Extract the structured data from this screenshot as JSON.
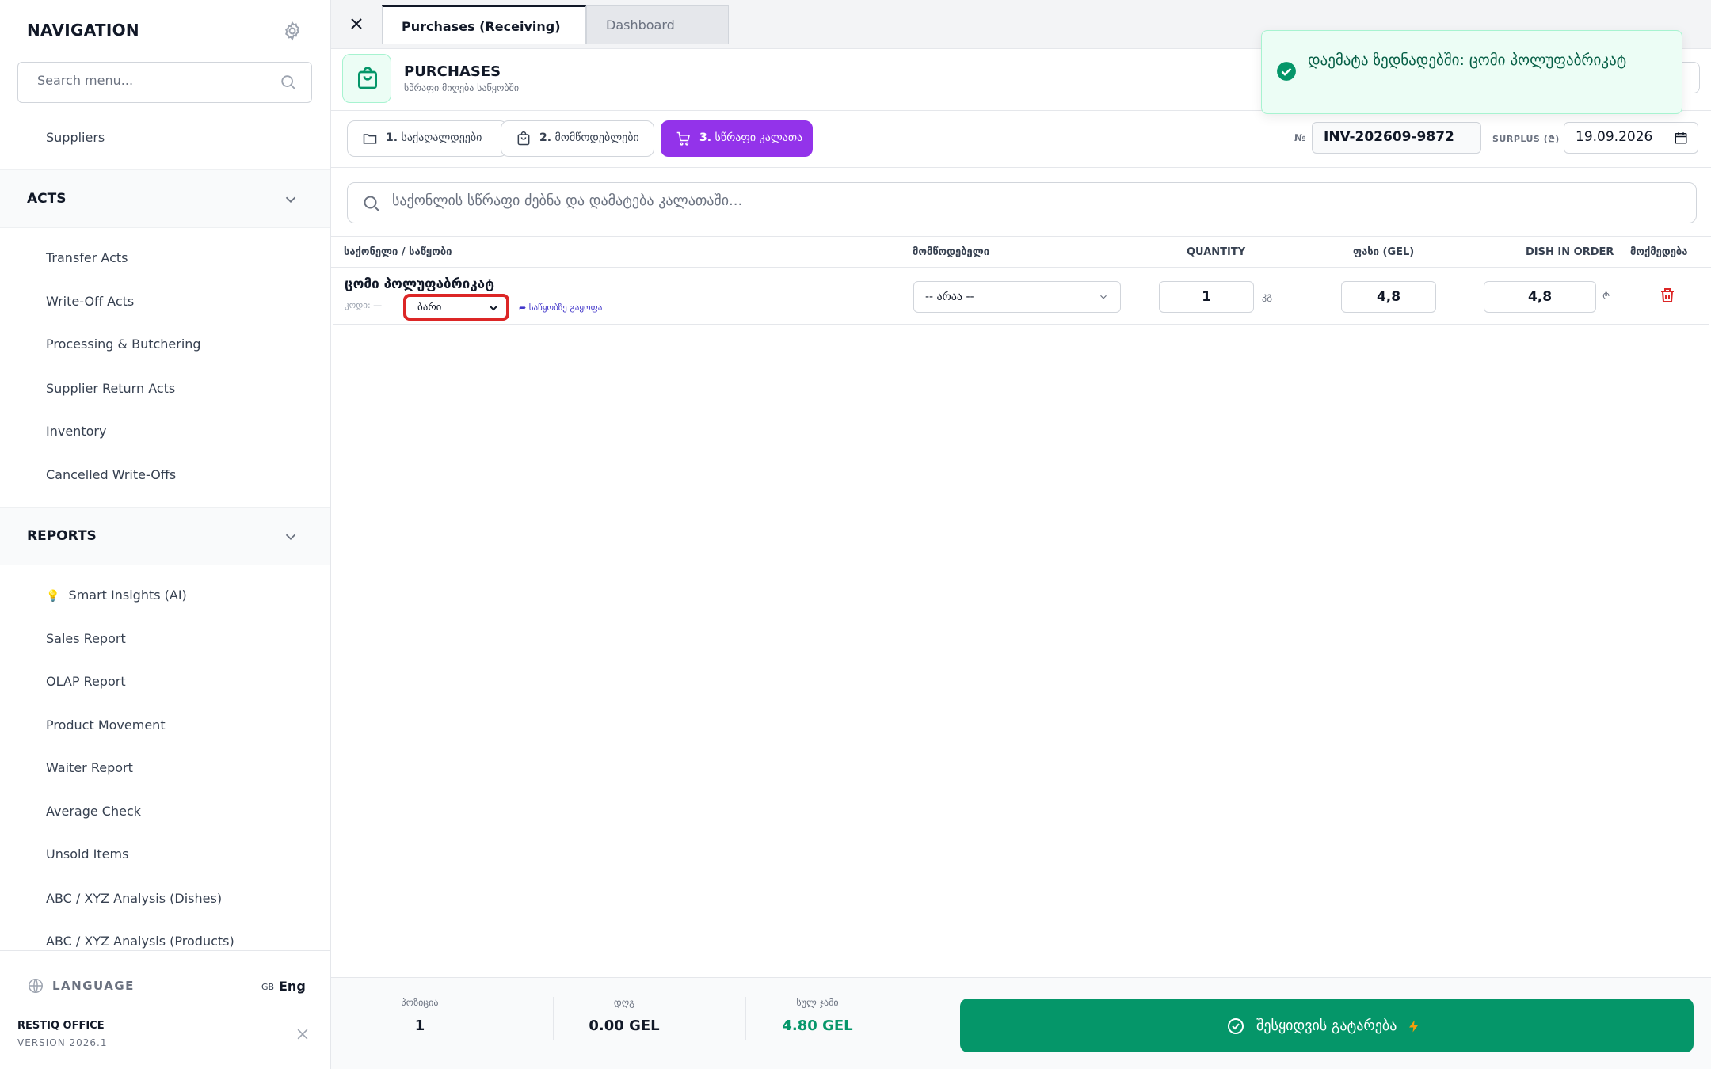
{
  "sidebar": {
    "title": "NAVIGATION",
    "search_placeholder": "Search menu...",
    "top_item": "Suppliers",
    "acts": {
      "label": "ACTS",
      "items": [
        "Transfer Acts",
        "Write-Off Acts",
        "Processing & Butchering",
        "Supplier Return Acts",
        "Inventory",
        "Cancelled Write-Offs"
      ]
    },
    "reports": {
      "label": "REPORTS",
      "items": [
        "Smart Insights (AI)",
        "Sales Report",
        "OLAP Report",
        "Product Movement",
        "Waiter Report",
        "Average Check",
        "Unsold Items",
        "ABC / XYZ Analysis (Dishes)",
        "ABC / XYZ Analysis (Products)"
      ]
    },
    "language_label": "LANGUAGE",
    "language_flag": "GB",
    "language_value": "Eng",
    "brand": "RESTIQ OFFICE",
    "version": "VERSION 2026.1"
  },
  "tabs": [
    {
      "label": "Purchases (Receiving)",
      "active": true
    },
    {
      "label": "Dashboard",
      "active": false
    }
  ],
  "header": {
    "title": "PURCHASES",
    "subtitle": "სწრაფი მიღება საწყობში"
  },
  "steps": [
    {
      "num": "1.",
      "label": "საქაღალდეები",
      "icon": "folder-icon",
      "active": false
    },
    {
      "num": "2.",
      "label": "მომწოდებლები",
      "icon": "bag-icon",
      "active": false
    },
    {
      "num": "3.",
      "label": "სწრაფი კალათა",
      "icon": "cart-icon",
      "active": true
    }
  ],
  "invoice": {
    "label": "№",
    "number": "INV-202609-9872",
    "surplus_label": "SURPLUS (₾)",
    "date": "19.09.2026"
  },
  "quick_search_placeholder": "საქონლის სწრაფი ძებნა და დამატება კალათაში...",
  "table": {
    "columns": [
      "საქონელი / საწყობი",
      "მომწოდებელი",
      "QUANTITY",
      "ფასი (GEL)",
      "DISH IN ORDER",
      "მოქმედება"
    ],
    "rows": [
      {
        "name": "ცომი პოლუფაბრიკატ",
        "code_label": "კოდი: —",
        "warehouse": "ბარი",
        "goto_link": "➦ საწყობზე გაყოფა",
        "supplier": "-- არაა --",
        "quantity": "1",
        "unit": "კგ",
        "price": "4,8",
        "dish_in_order": "4,8",
        "currency": "₾"
      }
    ]
  },
  "footer": {
    "positions_label": "პოზიცია",
    "positions_value": "1",
    "vat_label": "დღგ",
    "vat_value": "0.00 GEL",
    "total_label": "სულ ჯამი",
    "total_value": "4.80 GEL",
    "checkout_label": "შესყიდვის გატარება"
  },
  "toast": {
    "message": "დაემატა ზედნადებში: ცომი პოლუფაბრიკატ"
  },
  "colors": {
    "accent_purple": "#9333ea",
    "success_green": "#059669",
    "danger_red": "#dc2626"
  }
}
